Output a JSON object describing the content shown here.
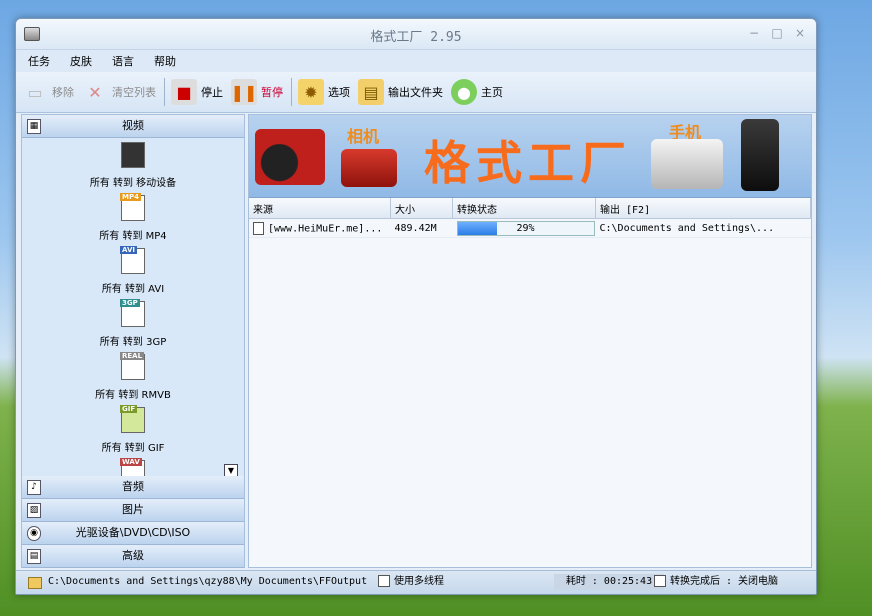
{
  "window": {
    "title": "格式工厂 2.95",
    "min": "−",
    "max": "□",
    "close": "×"
  },
  "menu": [
    "任务",
    "皮肤",
    "语言",
    "帮助"
  ],
  "toolbar": {
    "remove": "移除",
    "clear": "清空列表",
    "stop": "停止",
    "pause": "暂停",
    "options": "选项",
    "output_folder": "输出文件夹",
    "home": "主页"
  },
  "sidebar": {
    "video": "视频",
    "items": [
      {
        "tag": "",
        "label": "所有 转到 移动设备"
      },
      {
        "tag": "MP4",
        "label": "所有 转到 MP4"
      },
      {
        "tag": "AVI",
        "label": "所有 转到 AVI"
      },
      {
        "tag": "3GP",
        "label": "所有 转到 3GP"
      },
      {
        "tag": "REAL",
        "label": "所有 转到 RMVB"
      },
      {
        "tag": "GIF",
        "label": "所有 转到 GIF"
      },
      {
        "tag": "WAV",
        "label": ""
      }
    ],
    "audio": "音频",
    "image": "图片",
    "optical": "光驱设备\\DVD\\CD\\ISO",
    "advanced": "高级"
  },
  "banner": {
    "main": "格式工厂",
    "camera": "相机",
    "phone": "手机"
  },
  "table": {
    "headers": [
      "来源",
      "大小",
      "转换状态",
      "输出 [F2]"
    ],
    "rows": [
      {
        "source": "[www.HeiMuEr.me]...",
        "size": "489.42M",
        "progress_percent": 29,
        "status": "29%",
        "output": "C:\\Documents and Settings\\..."
      }
    ]
  },
  "status": {
    "path": "C:\\Documents and Settings\\qzy88\\My Documents\\FFOutput",
    "multithread": "使用多线程",
    "elapsed": "耗时 : 00:25:43",
    "after": "转换完成后 : 关闭电脑"
  },
  "colors": {
    "accent": "#2b7ee6",
    "banner_text": "#f76c1c"
  }
}
